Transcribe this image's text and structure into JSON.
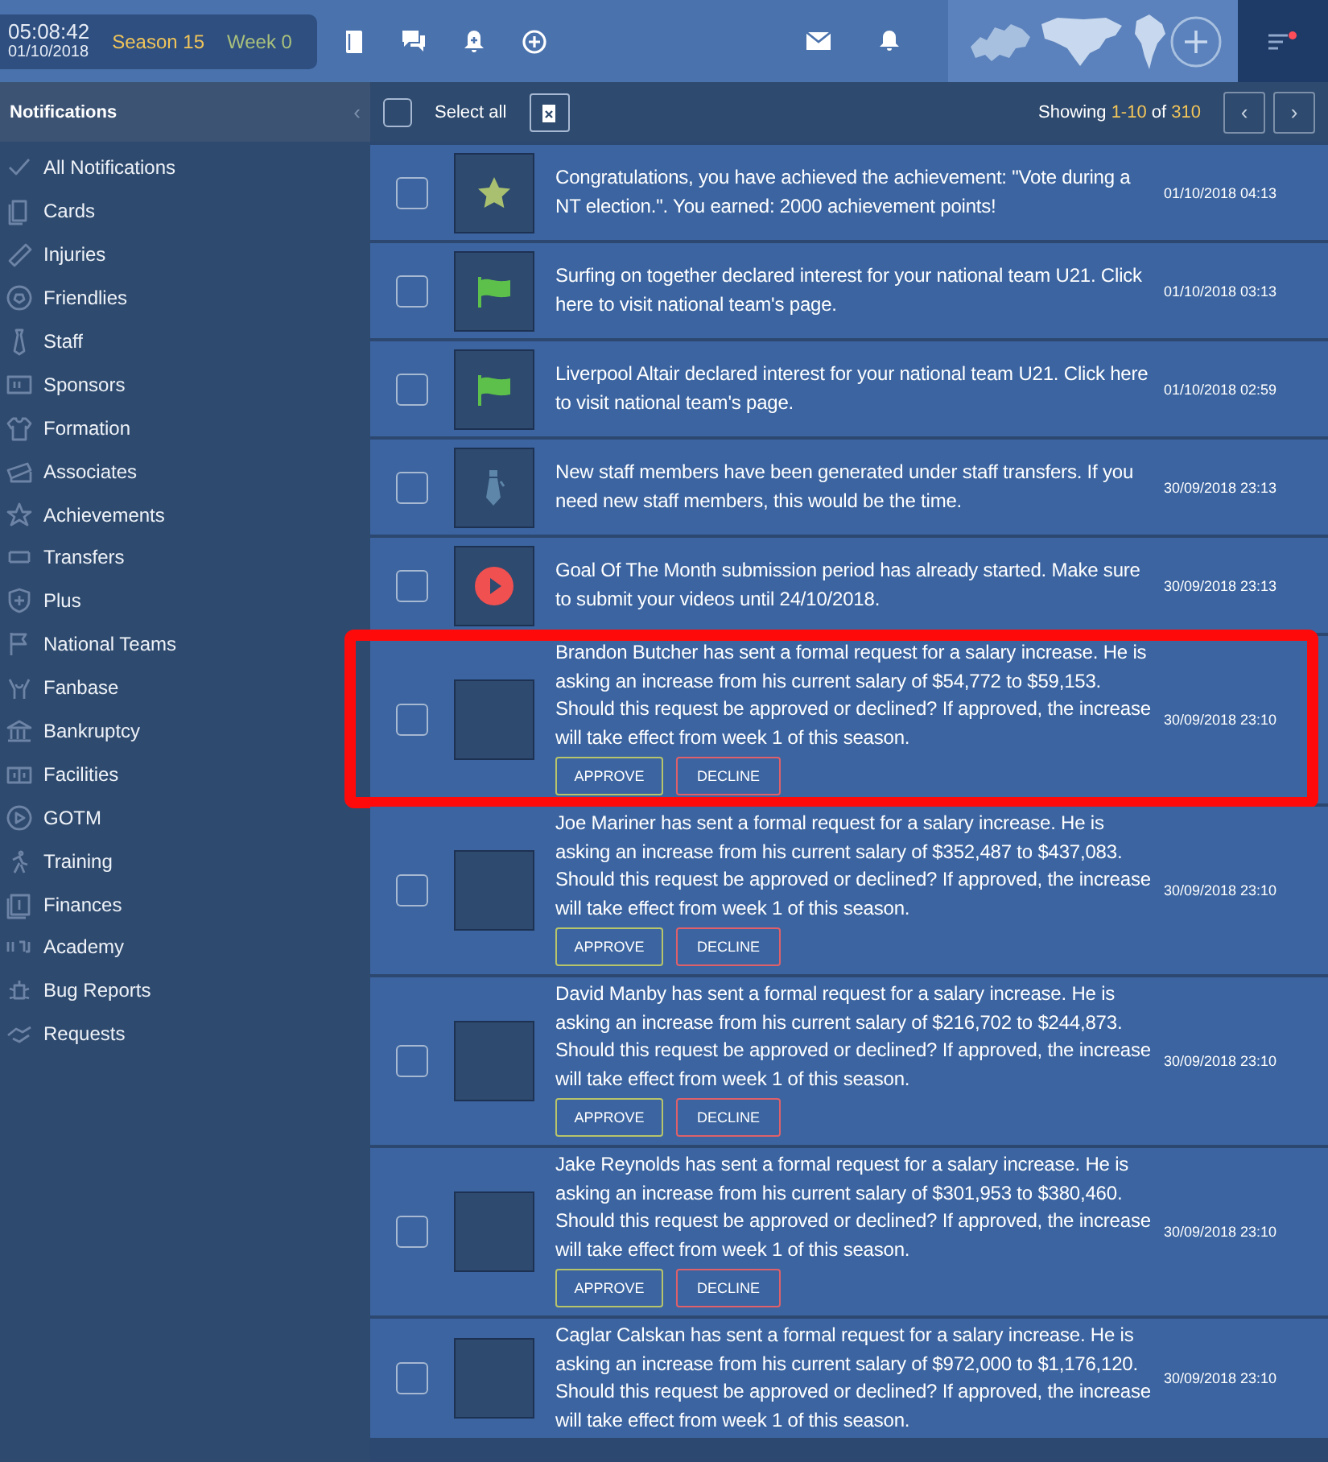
{
  "topbar": {
    "time": "05:08:42",
    "date": "01/10/2018",
    "season": "Season 15",
    "week": "Week 0"
  },
  "sidebar": {
    "title": "Notifications",
    "collapse": "‹",
    "items": [
      {
        "label": "All Notifications",
        "selected": false
      },
      {
        "label": "Cards",
        "selected": false
      },
      {
        "label": "Injuries",
        "selected": false
      },
      {
        "label": "Friendlies",
        "selected": false
      },
      {
        "label": "Staff",
        "selected": false
      },
      {
        "label": "Sponsors",
        "selected": false
      },
      {
        "label": "Formation",
        "selected": false
      },
      {
        "label": "Associates",
        "selected": false
      },
      {
        "label": "Achievements",
        "selected": false
      },
      {
        "label": "Transfers",
        "selected": false
      },
      {
        "label": "Plus",
        "selected": false
      },
      {
        "label": "National Teams",
        "selected": false
      },
      {
        "label": "Fanbase",
        "selected": false
      },
      {
        "label": "Bankruptcy",
        "selected": false
      },
      {
        "label": "Facilities",
        "selected": false
      },
      {
        "label": "GOTM",
        "selected": false
      },
      {
        "label": "Training",
        "selected": false
      },
      {
        "label": "Finances",
        "selected": false
      },
      {
        "label": "Academy",
        "selected": false
      },
      {
        "label": "Bug Reports",
        "selected": false
      },
      {
        "label": "Requests",
        "selected": false
      }
    ]
  },
  "toolbar": {
    "select_all": {
      "label": "Select all",
      "checked": false
    },
    "showing": {
      "label": "Showing",
      "range": "1-10",
      "of": "of",
      "total": "310"
    },
    "prev": "‹",
    "next": "›"
  },
  "notifications": [
    {
      "kind": "star",
      "checked": false,
      "highlighted": false,
      "text": "Congratulations, you have achieved the achievement: \"Vote during a NT election.\". You earned: 2000 achievement points!",
      "time": "01/10/2018 04:13"
    },
    {
      "kind": "flag",
      "checked": false,
      "highlighted": false,
      "text": "Surfing on together declared interest for your national team U21. Click here to visit national team's page.",
      "time": "01/10/2018 03:13"
    },
    {
      "kind": "flag",
      "checked": false,
      "highlighted": false,
      "text": "Liverpool Altair declared interest for your national team U21. Click here to visit national team's page.",
      "time": "01/10/2018 02:59"
    },
    {
      "kind": "tie",
      "checked": false,
      "highlighted": false,
      "text": "New staff members have been generated under staff transfers. If you need new staff members, this would be the time.",
      "time": "30/09/2018 23:13"
    },
    {
      "kind": "play",
      "checked": false,
      "highlighted": false,
      "text": "Goal Of The Month submission period has already started. Make sure to submit your videos until 24/10/2018.",
      "time": "30/09/2018 23:13"
    },
    {
      "kind": "blank",
      "checked": false,
      "highlighted": true,
      "text": "Brandon Butcher has sent a formal request for a salary increase. He is asking an increase from his current salary of $54,772 to $59,153. Should this request be approved or declined? If approved, the increase will take effect from week 1 of this season.",
      "time": "30/09/2018 23:10",
      "buttons": [
        {
          "label": "APPROVE",
          "kind": "approve"
        },
        {
          "label": "DECLINE",
          "kind": "decline"
        }
      ]
    },
    {
      "kind": "blank",
      "checked": false,
      "highlighted": false,
      "text": "Joe Mariner has sent a formal request for a salary increase. He is asking an increase from his current salary of $352,487 to $437,083. Should this request be approved or declined? If approved, the increase will take effect from week 1 of this season.",
      "time": "30/09/2018 23:10",
      "buttons": [
        {
          "label": "APPROVE",
          "kind": "approve"
        },
        {
          "label": "DECLINE",
          "kind": "decline"
        }
      ]
    },
    {
      "kind": "blank",
      "checked": false,
      "highlighted": false,
      "text": "David Manby has sent a formal request for a salary increase. He is asking an increase from his current salary of $216,702 to $244,873. Should this request be approved or declined? If approved, the increase will take effect from week 1 of this season.",
      "time": "30/09/2018 23:10",
      "buttons": [
        {
          "label": "APPROVE",
          "kind": "approve"
        },
        {
          "label": "DECLINE",
          "kind": "decline"
        }
      ]
    },
    {
      "kind": "blank",
      "checked": false,
      "highlighted": false,
      "text": "Jake Reynolds has sent a formal request for a salary increase. He is asking an increase from his current salary of $301,953 to $380,460. Should this request be approved or declined? If approved, the increase will take effect from week 1 of this season.",
      "time": "30/09/2018 23:10",
      "buttons": [
        {
          "label": "APPROVE",
          "kind": "approve"
        },
        {
          "label": "DECLINE",
          "kind": "decline"
        }
      ]
    },
    {
      "kind": "blank",
      "checked": false,
      "highlighted": false,
      "text": "Caglar Calskan has sent a formal request for a salary increase. He is asking an increase from his current salary of $972,000 to $1,176,120. Should this request be approved or declined? If approved, the increase will take effect from week 1 of this season.",
      "time": "30/09/2018 23:10"
    }
  ]
}
